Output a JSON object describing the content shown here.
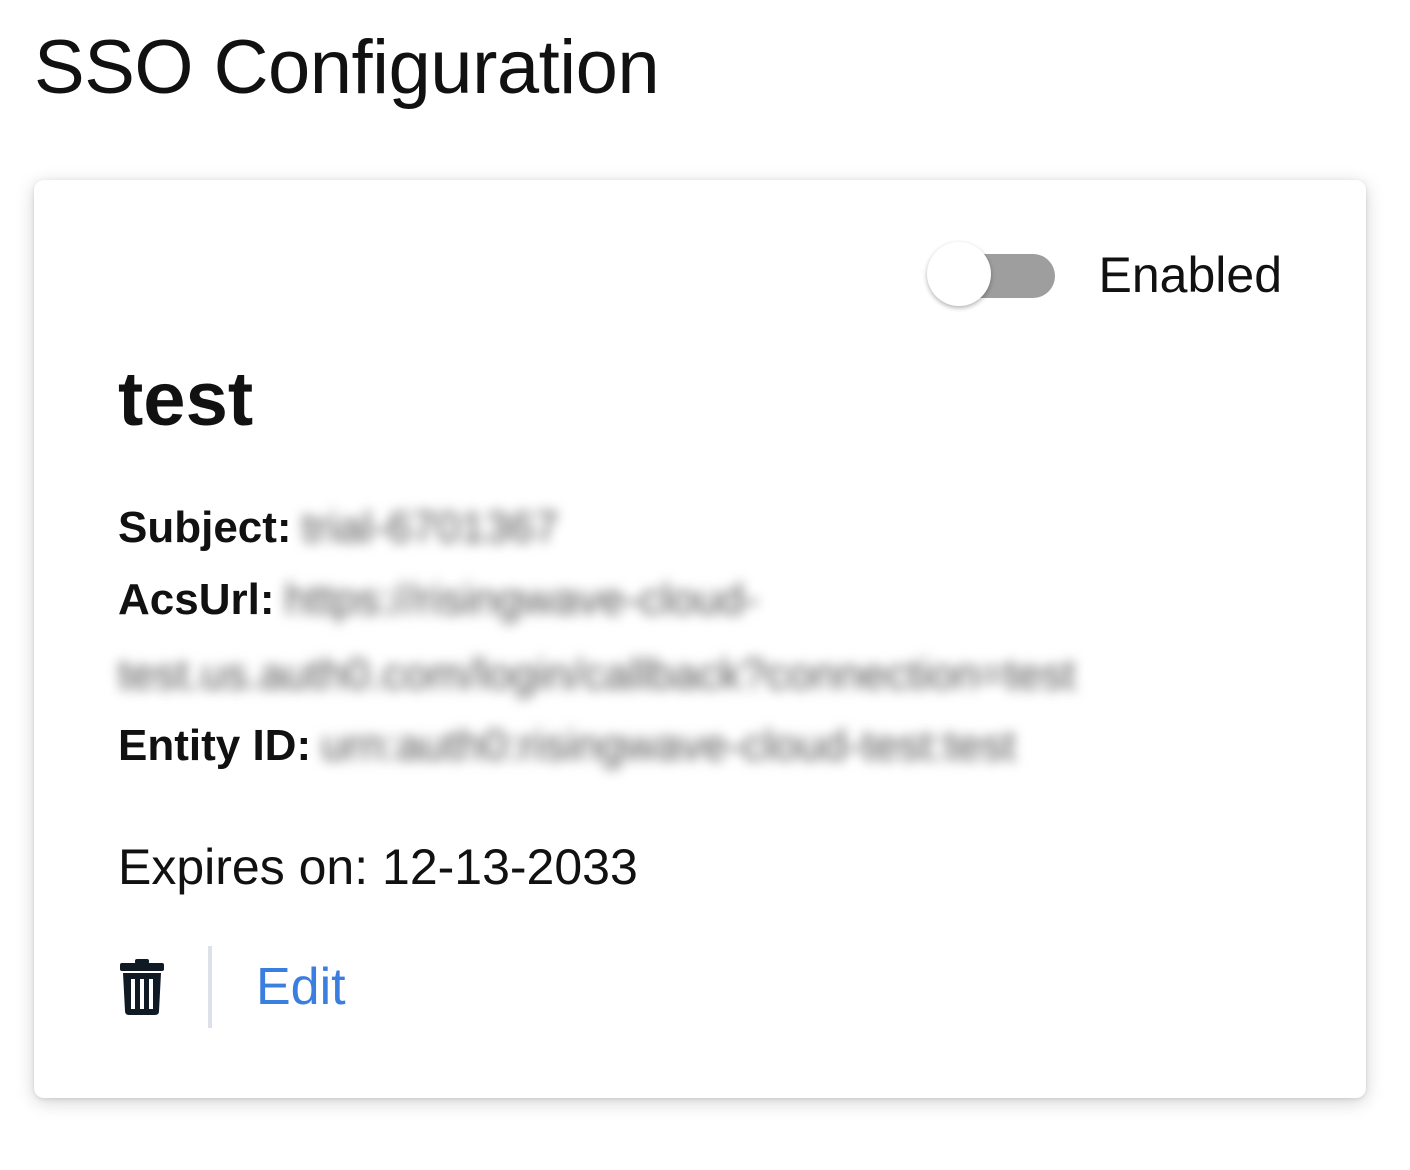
{
  "page": {
    "title": "SSO Configuration"
  },
  "card": {
    "toggle": {
      "label": "Enabled",
      "state": "off",
      "track_color": "#9e9e9e"
    },
    "name": "test",
    "fields": {
      "subject_label": "Subject:",
      "subject_value": "trial-6701367",
      "acs_url_label": "AcsUrl:",
      "acs_url_value_line1": "https://risingwave-cloud-",
      "acs_url_value_line2": "test.us.auth0.com/login/callback?connection=test",
      "entity_id_label": "Entity ID:",
      "entity_id_value": "urn:auth0:risingwave-cloud-test:test"
    },
    "expires": "Expires on: 12-13-2033",
    "actions": {
      "delete_icon": "trash-icon",
      "edit_label": "Edit",
      "link_color": "#3a7ee0"
    }
  }
}
